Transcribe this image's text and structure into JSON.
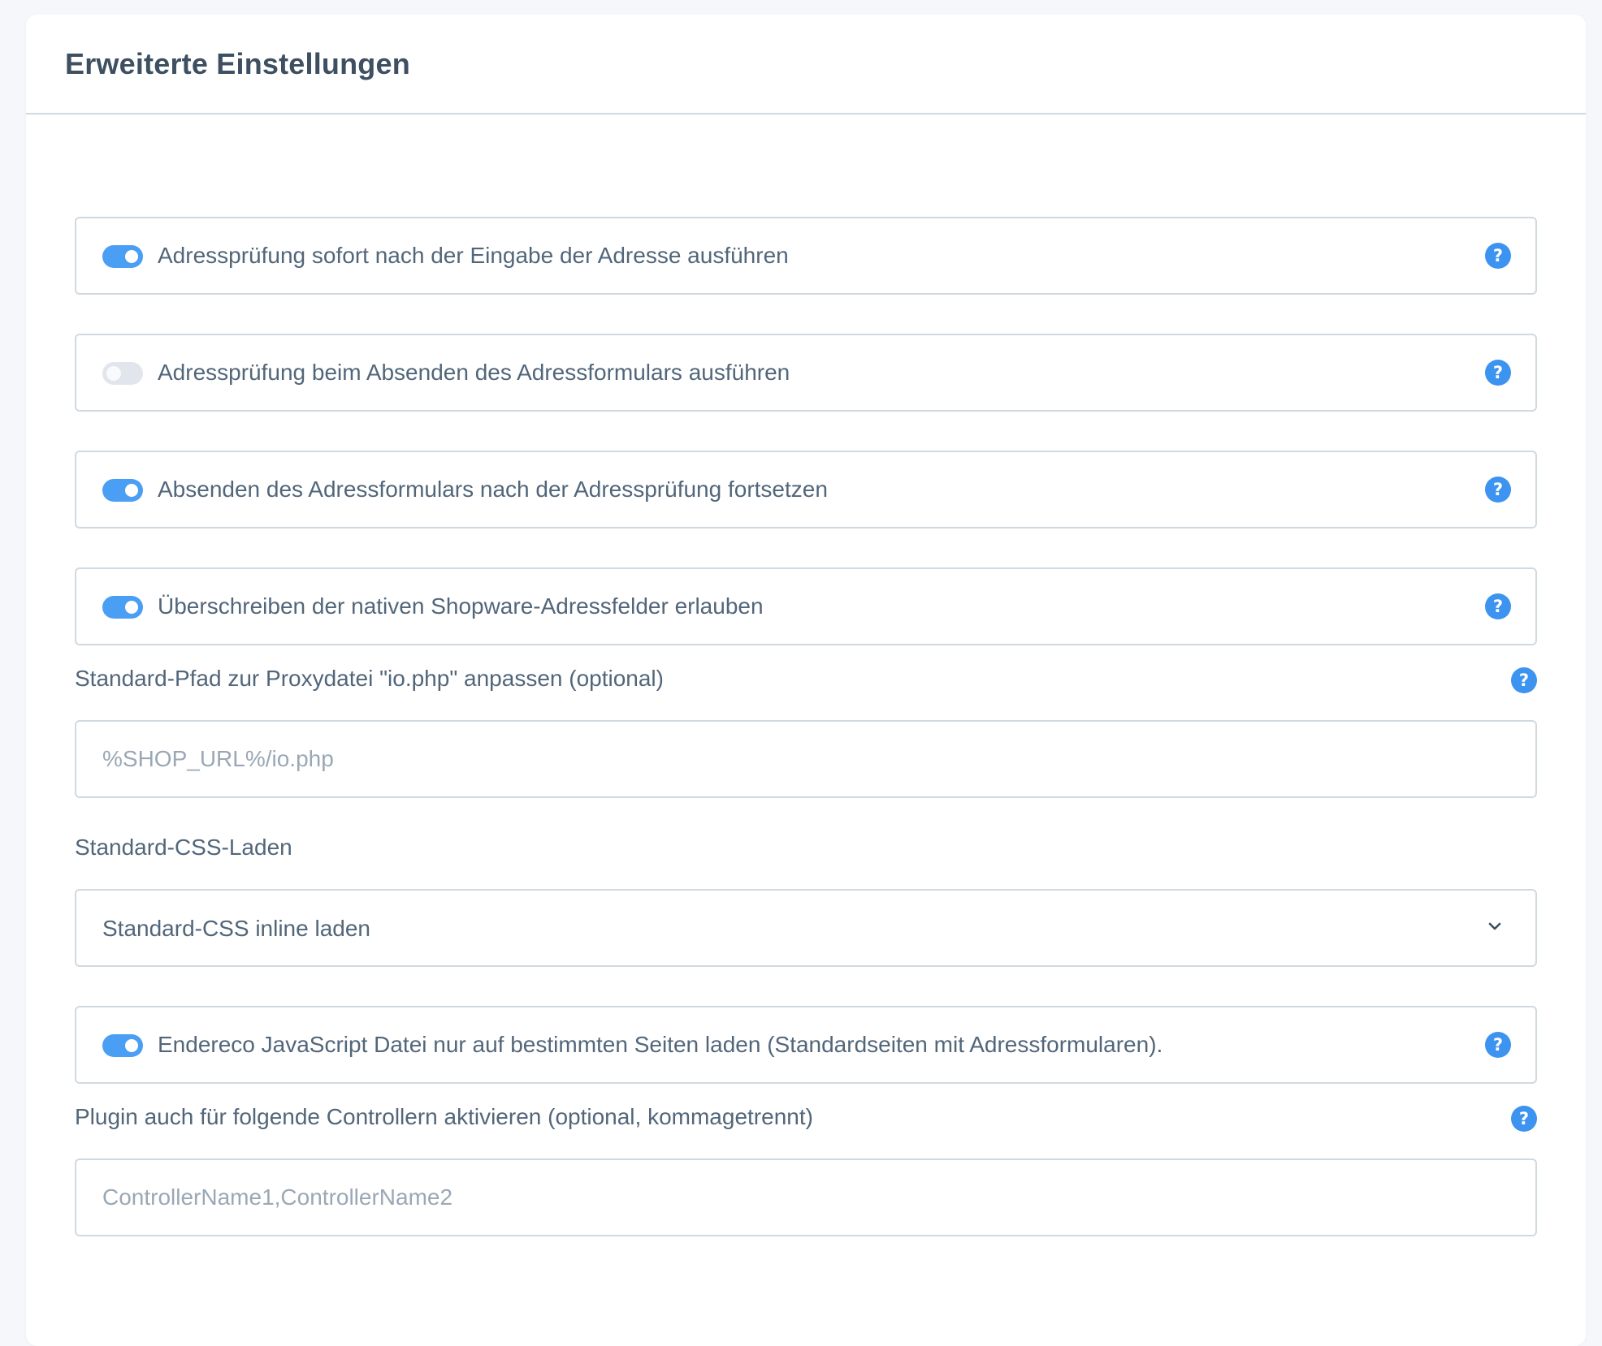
{
  "title": "Erweiterte Einstellungen",
  "accent_color": "#3d93f0",
  "help_icon_glyph": "?",
  "settings": {
    "check_after_input": {
      "label": "Adressprüfung sofort nach der Eingabe der Adresse ausführen",
      "enabled": true
    },
    "check_on_submit": {
      "label": "Adressprüfung beim Absenden des Adressformulars ausführen",
      "enabled": false
    },
    "continue_submit": {
      "label": "Absenden des Adressformulars nach der Adressprüfung fortsetzen",
      "enabled": true
    },
    "overwrite_fields": {
      "label": "Überschreiben der nativen Shopware-Adressfelder erlauben",
      "enabled": true
    },
    "proxy_path": {
      "label": "Standard-Pfad zur Proxydatei \"io.php\" anpassen (optional)",
      "value": "",
      "placeholder": "%SHOP_URL%/io.php"
    },
    "css_loading": {
      "label": "Standard-CSS-Laden",
      "selected": "Standard-CSS inline laden"
    },
    "js_specific_pages": {
      "label": "Endereco JavaScript Datei nur auf bestimmten Seiten laden (Standardseiten mit Adressformularen).",
      "enabled": true
    },
    "controllers": {
      "label": "Plugin auch für folgende Controllern aktivieren (optional, kommagetrennt)",
      "value": "",
      "placeholder": "ControllerName1,ControllerName2"
    }
  }
}
